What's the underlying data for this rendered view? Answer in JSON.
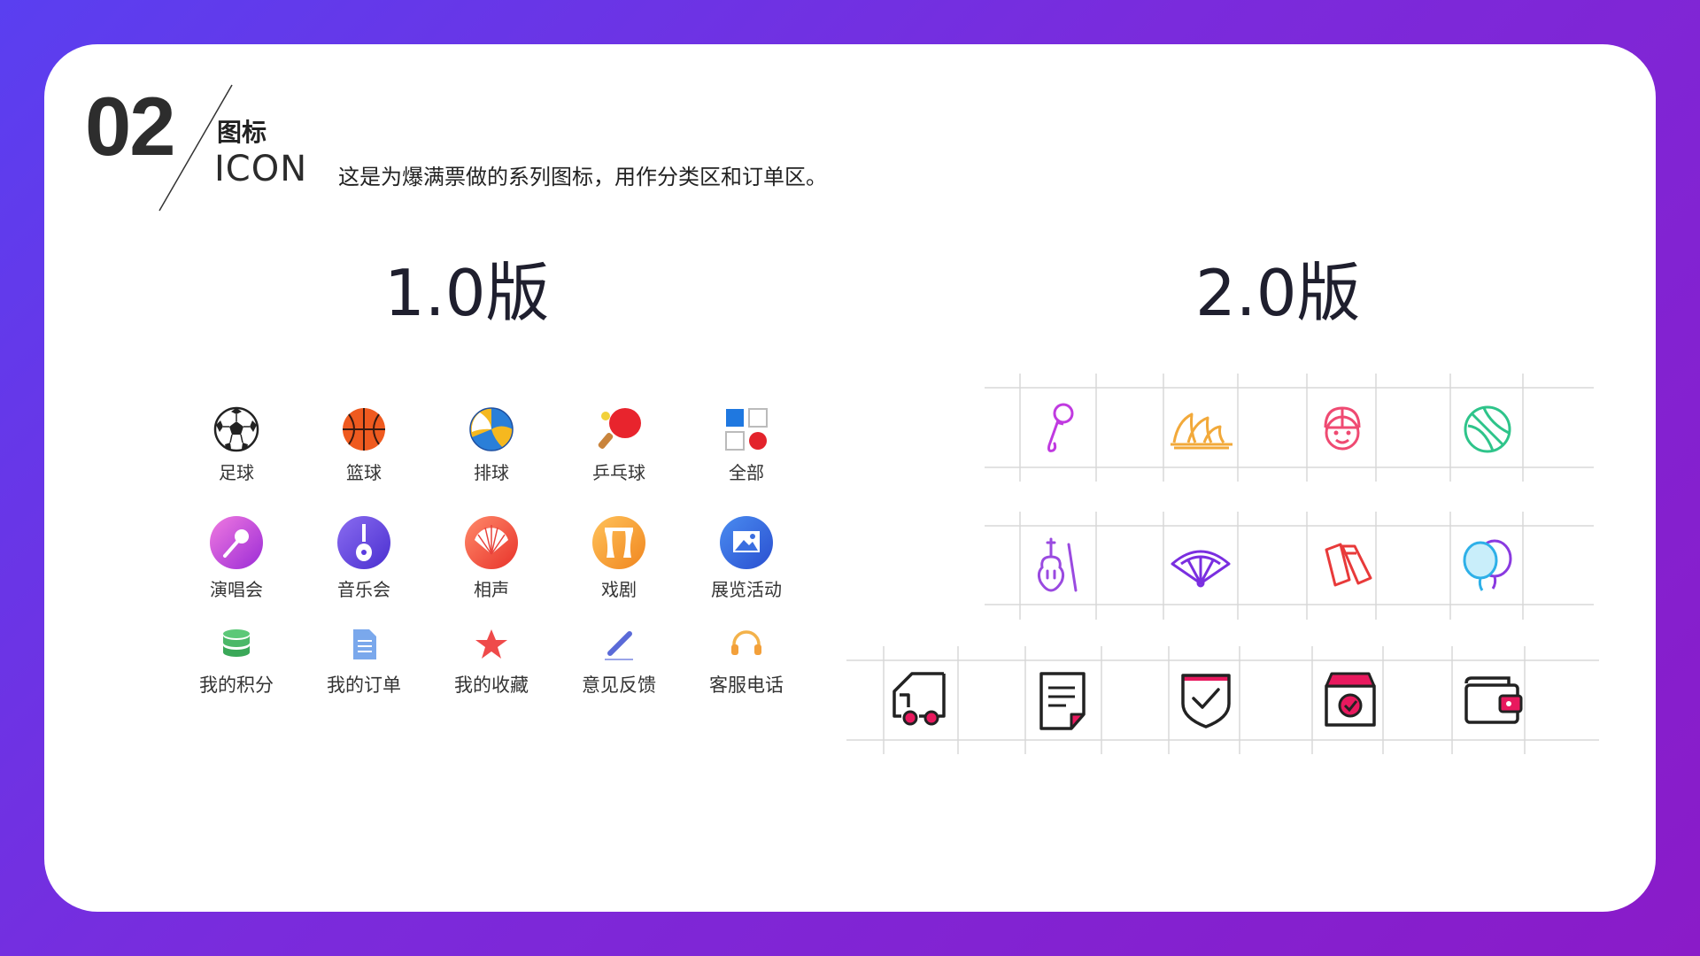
{
  "header": {
    "number": "02",
    "title_cn": "图标",
    "title_en": "ICON",
    "description": "这是为爆满票做的系列图标，用作分类区和订单区。"
  },
  "colors": {
    "bg_gradient_start": "#5a3ff0",
    "bg_gradient_end": "#8a1bc8",
    "card": "#ffffff",
    "accent_pink": "#e8195e"
  },
  "version1": {
    "title": "1.0版",
    "rows": [
      [
        {
          "label": "足球",
          "icon": "soccer-ball-icon"
        },
        {
          "label": "篮球",
          "icon": "basketball-icon"
        },
        {
          "label": "排球",
          "icon": "volleyball-icon"
        },
        {
          "label": "乒乓球",
          "icon": "ping-pong-icon"
        },
        {
          "label": "全部",
          "icon": "all-grid-icon"
        }
      ],
      [
        {
          "label": "演唱会",
          "icon": "microphone-icon"
        },
        {
          "label": "音乐会",
          "icon": "guitar-icon"
        },
        {
          "label": "相声",
          "icon": "fan-icon"
        },
        {
          "label": "戏剧",
          "icon": "theater-icon"
        },
        {
          "label": "展览活动",
          "icon": "picture-icon"
        }
      ],
      [
        {
          "label": "我的积分",
          "icon": "coins-icon"
        },
        {
          "label": "我的订单",
          "icon": "document-icon"
        },
        {
          "label": "我的收藏",
          "icon": "star-icon"
        },
        {
          "label": "意见反馈",
          "icon": "pen-icon"
        },
        {
          "label": "客服电话",
          "icon": "headset-icon"
        }
      ]
    ]
  },
  "version2": {
    "title": "2.0版",
    "rows": [
      [
        "microphone-icon",
        "opera-house-icon",
        "child-face-icon",
        "basketball-icon"
      ],
      [
        "violin-icon",
        "fan-icon",
        "tickets-icon",
        "balloons-icon"
      ],
      [
        "truck-icon",
        "order-sheet-icon",
        "shield-check-icon",
        "box-check-icon",
        "wallet-icon"
      ]
    ]
  }
}
